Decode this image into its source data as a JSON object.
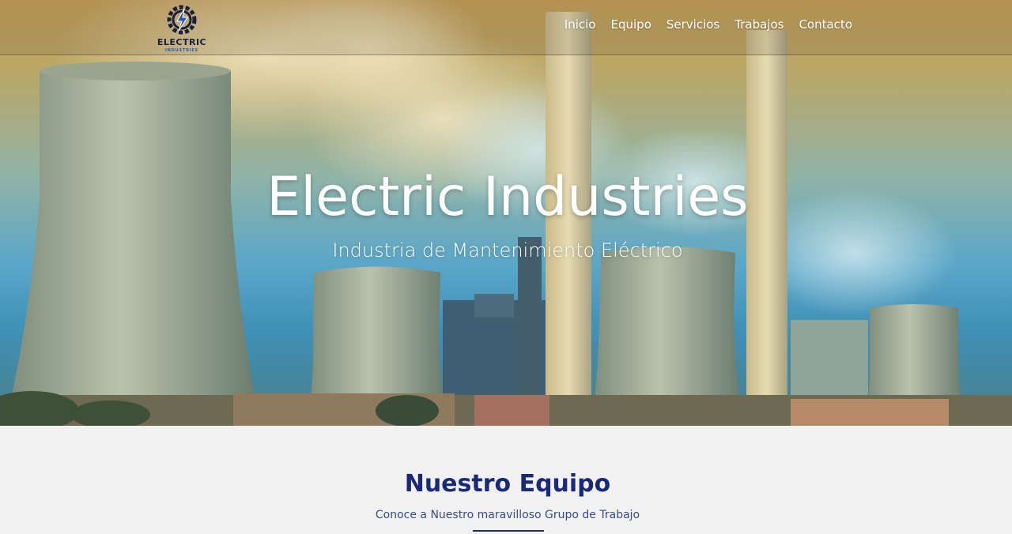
{
  "brand": {
    "name": "ELECTRIC",
    "tagline": "INDUSTRIES"
  },
  "nav": {
    "items": [
      {
        "label": "Inicio"
      },
      {
        "label": "Equipo"
      },
      {
        "label": "Servicios"
      },
      {
        "label": "Trabajos"
      },
      {
        "label": "Contacto"
      }
    ]
  },
  "hero": {
    "title": "Electric Industries",
    "subtitle": "Industria de Mantenimiento Eléctrico"
  },
  "team_section": {
    "title": "Nuestro Equipo",
    "subtitle": "Conoce a Nuestro maravilloso Grupo de Trabajo"
  },
  "colors": {
    "accent": "#1b2a78",
    "logo_blue": "#2a57b8",
    "nav_text": "#ffffff",
    "section_bg": "#f1f1f1"
  }
}
